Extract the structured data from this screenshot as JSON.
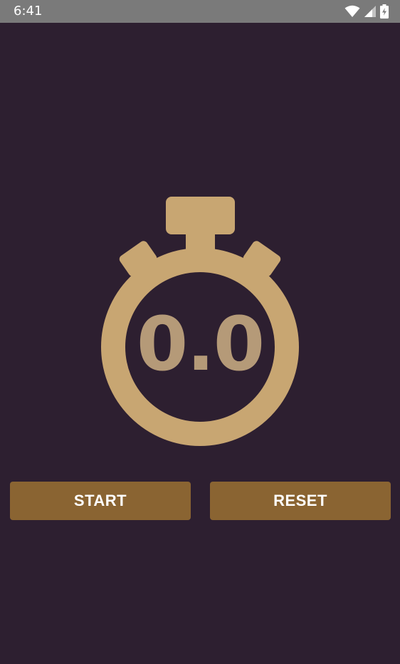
{
  "status_bar": {
    "time": "6:41",
    "icons": [
      "wifi-icon",
      "signal-icon",
      "battery-charging-icon"
    ]
  },
  "stopwatch": {
    "display": "0.0",
    "accent_color": "#c8a672",
    "digit_color": "#b59a78",
    "background_color": "#2d1f30"
  },
  "buttons": {
    "start_label": "START",
    "reset_label": "RESET",
    "button_color": "#8a6432"
  }
}
